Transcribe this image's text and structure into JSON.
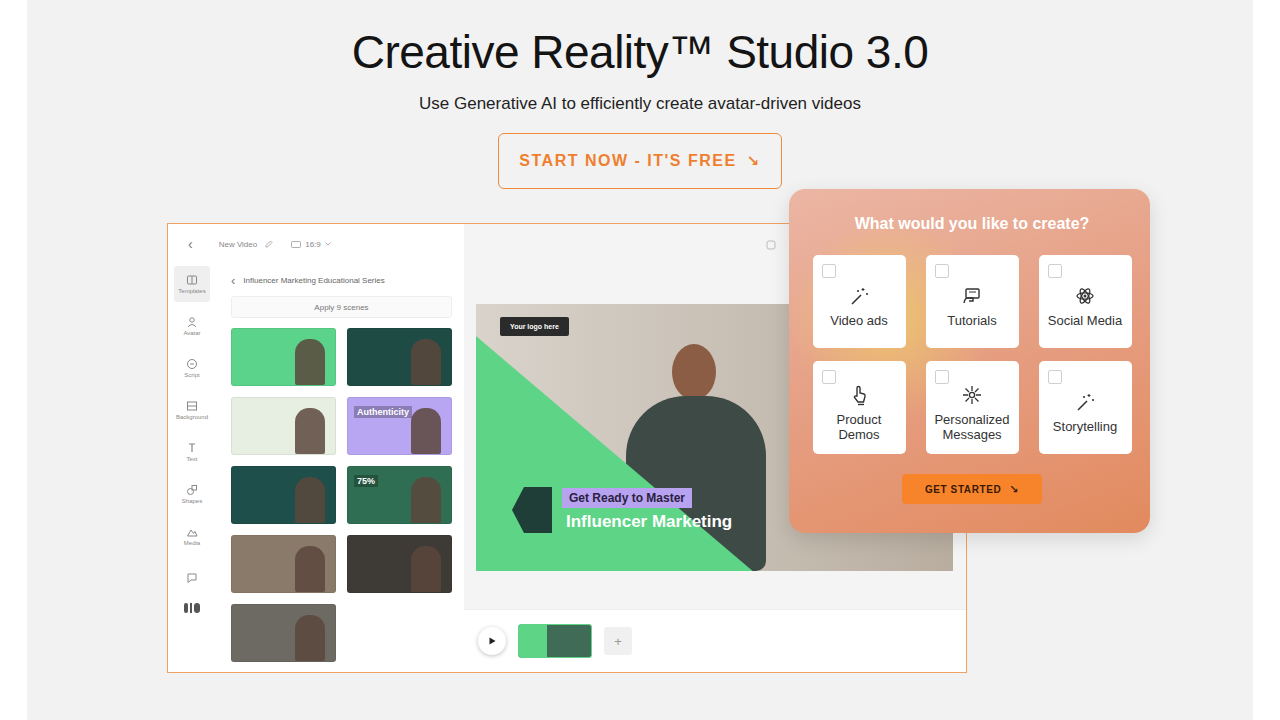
{
  "hero": {
    "title": "Creative Reality™ Studio 3.0",
    "subtitle": "Use Generative AI to efficiently create avatar-driven videos",
    "cta": {
      "label": "START NOW - IT'S FREE",
      "icon": "↘"
    }
  },
  "editor": {
    "topbar": {
      "back": "‹",
      "title": "New Video",
      "ratio": "16:9"
    },
    "rail": [
      {
        "label": "Templates",
        "selected": true
      },
      {
        "label": "Avatar",
        "selected": false
      },
      {
        "label": "Script",
        "selected": false
      },
      {
        "label": "Background",
        "selected": false
      },
      {
        "label": "Text",
        "selected": false
      },
      {
        "label": "Shapes",
        "selected": false
      },
      {
        "label": "Media",
        "selected": false
      }
    ],
    "panel": {
      "back": "‹",
      "title": "Influencer Marketing Educational Series",
      "apply": "Apply 9 scenes",
      "thumbnails": [
        {
          "text": "",
          "color": "#5bd38a"
        },
        {
          "text": "",
          "color": "#1f4b45"
        },
        {
          "text": "",
          "color": "#e6efe2"
        },
        {
          "text": "Authenticity",
          "color": "#b9a6f2"
        },
        {
          "text": "",
          "color": "#1e4f4a"
        },
        {
          "text": "75%",
          "color": "#2f6e52"
        },
        {
          "text": "",
          "color": "#8a7a6a"
        },
        {
          "text": "",
          "color": "#3e3a35"
        },
        {
          "text": "",
          "color": "#6c6a62"
        }
      ]
    },
    "canvas": {
      "logo": "Your logo here",
      "kicker": "Get Ready to Master",
      "headline": "Influencer Marketing"
    },
    "timeline": {
      "add": "+"
    }
  },
  "picker": {
    "title": "What would you like to create?",
    "options": [
      {
        "label": "Video ads",
        "checked": false
      },
      {
        "label": "Tutorials",
        "checked": false
      },
      {
        "label": "Social Media",
        "checked": false
      },
      {
        "label": "Product Demos",
        "checked": false
      },
      {
        "label": "Personalized Messages",
        "checked": false
      },
      {
        "label": "Storytelling",
        "checked": false
      }
    ],
    "button": {
      "label": "GET STARTED",
      "icon": "↘"
    }
  }
}
